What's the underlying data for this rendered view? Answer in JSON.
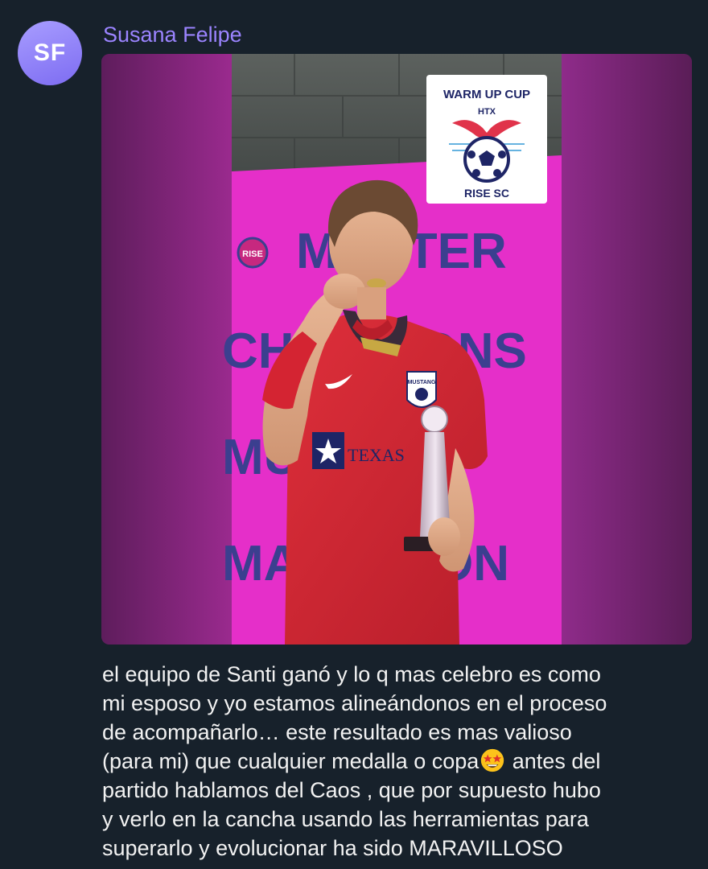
{
  "sender": {
    "initials": "SF",
    "name": "Susana Felipe"
  },
  "media": {
    "logo_top_text": "WARM UP CUP",
    "logo_mid_text": "HTX",
    "logo_bottom_text": "RISE SC",
    "banner_rows": [
      "MASTER",
      "CHAMPIONS",
      "MUJERES",
      "MARATHON"
    ],
    "rise_badge_text": "RISE",
    "jersey_sponsor_text": "TEXAS",
    "jersey_crest_text": "MUSTANG"
  },
  "message": {
    "text_part1": "el equipo de Santi ganó y lo q mas celebro es como\nmi esposo y yo estamos alineándonos en el proceso\nde acompañarlo… este resultado es mas valioso\n(para mi) que cualquier medalla o copa",
    "emoji": "star-struck-emoji",
    "text_part2": " antes del\npartido hablamos del Caos , que por supuesto hubo\ny verlo en la cancha usando las herramientas para\nsuperarlo y evolucionar ha sido MARAVILLOSO"
  },
  "colors": {
    "background": "#17212b",
    "sender_name": "#9b84ff",
    "banner_pink": "#e52fc9",
    "banner_text": "#3b3f8f",
    "jersey_red": "#d92634"
  }
}
